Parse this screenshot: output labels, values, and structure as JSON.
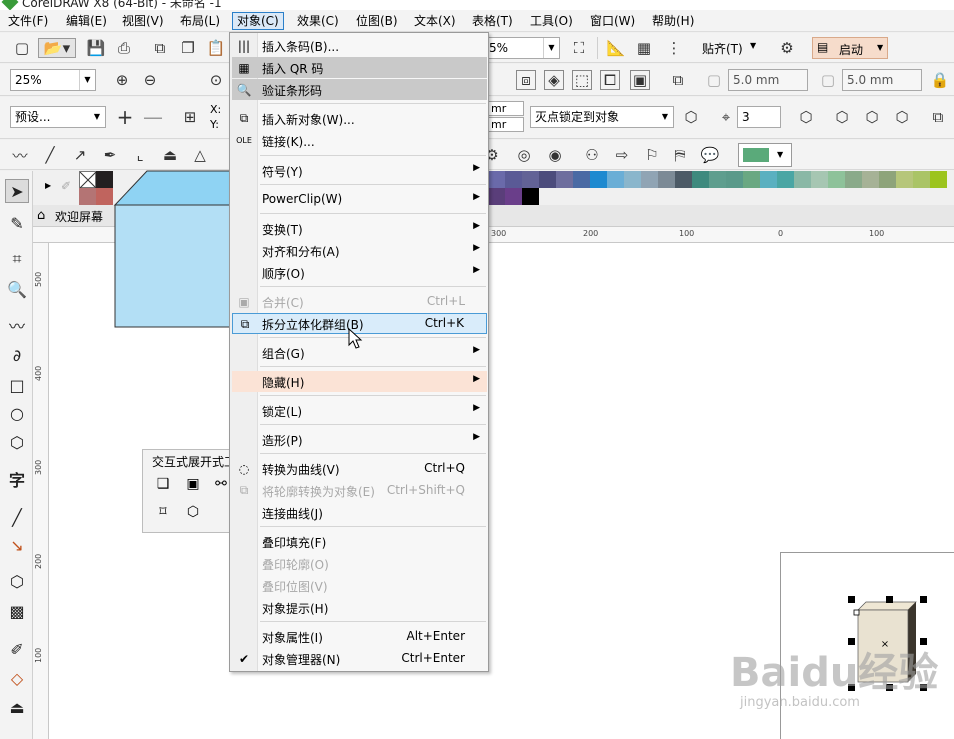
{
  "window": {
    "title": "CorelDRAW X8 (64-Bit) - 未命名 -1"
  },
  "menubar": {
    "items": [
      {
        "label": "文件(F)"
      },
      {
        "label": "编辑(E)"
      },
      {
        "label": "视图(V)"
      },
      {
        "label": "布局(L)"
      },
      {
        "label": "对象(C)"
      },
      {
        "label": "效果(C)"
      },
      {
        "label": "位图(B)"
      },
      {
        "label": "文本(X)"
      },
      {
        "label": "表格(T)"
      },
      {
        "label": "工具(O)"
      },
      {
        "label": "窗口(W)"
      },
      {
        "label": "帮助(H)"
      }
    ],
    "active_index": 4
  },
  "toolbar1": {
    "zoom_value": "5%",
    "snap_label": "贴齐(T)",
    "launch_label": "启动"
  },
  "toolbar2": {
    "zoom_value": "25%",
    "nudge_a": "5.0 mm",
    "nudge_b": "5.0 mm"
  },
  "toolbar3": {
    "preset_value": "预设...",
    "x_label": "X:",
    "y_label": "Y:",
    "unit_a": "mr",
    "unit_b": "mr",
    "vanish_option": "灭点锁定到对象",
    "depth_value": "3"
  },
  "docker_tab": {
    "label": "欢迎屏幕"
  },
  "ruler": {
    "h_ticks": [
      "300",
      "200",
      "100",
      "0",
      "100"
    ],
    "v_ticks": [
      "500",
      "400",
      "300",
      "200",
      "100"
    ]
  },
  "popup": {
    "title": "交互式展开式工"
  },
  "menu": {
    "items": [
      {
        "label": "插入条码(B)...",
        "shortcut": "",
        "submenu": false,
        "icon": "barcode-icon"
      },
      {
        "label": "插入 QR 码",
        "shortcut": "",
        "submenu": false,
        "icon": "qr-code-icon"
      },
      {
        "label": "验证条形码",
        "shortcut": "",
        "submenu": false,
        "icon": "verify-barcode-icon"
      },
      {
        "label": "插入新对象(W)...",
        "shortcut": "",
        "submenu": false,
        "icon": "insert-object-icon"
      },
      {
        "label": "链接(K)...",
        "shortcut": "",
        "submenu": false,
        "icon": "ole-link-icon"
      },
      {
        "label": "符号(Y)",
        "shortcut": "",
        "submenu": true
      },
      {
        "label": "PowerClip(W)",
        "shortcut": "",
        "submenu": true
      },
      {
        "label": "变换(T)",
        "shortcut": "",
        "submenu": true
      },
      {
        "label": "对齐和分布(A)",
        "shortcut": "",
        "submenu": true
      },
      {
        "label": "顺序(O)",
        "shortcut": "",
        "submenu": true
      },
      {
        "label": "合并(C)",
        "shortcut": "Ctrl+L",
        "submenu": false,
        "disabled": true,
        "icon": "combine-icon"
      },
      {
        "label": "拆分立体化群组(B)",
        "shortcut": "Ctrl+K",
        "submenu": false,
        "icon": "break-apart-icon"
      },
      {
        "label": "组合(G)",
        "shortcut": "",
        "submenu": true
      },
      {
        "label": "隐藏(H)",
        "shortcut": "",
        "submenu": true
      },
      {
        "label": "锁定(L)",
        "shortcut": "",
        "submenu": true
      },
      {
        "label": "造形(P)",
        "shortcut": "",
        "submenu": true
      },
      {
        "label": "转换为曲线(V)",
        "shortcut": "Ctrl+Q",
        "submenu": false,
        "icon": "convert-curves-icon"
      },
      {
        "label": "将轮廓转换为对象(E)",
        "shortcut": "Ctrl+Shift+Q",
        "submenu": false,
        "disabled": true,
        "icon": "outline-to-object-icon"
      },
      {
        "label": "连接曲线(J)",
        "shortcut": "",
        "submenu": false
      },
      {
        "label": "叠印填充(F)",
        "shortcut": "",
        "submenu": false
      },
      {
        "label": "叠印轮廓(O)",
        "shortcut": "",
        "submenu": false,
        "disabled": true
      },
      {
        "label": "叠印位图(V)",
        "shortcut": "",
        "submenu": false,
        "disabled": true
      },
      {
        "label": "对象提示(H)",
        "shortcut": "",
        "submenu": false
      },
      {
        "label": "对象属性(I)",
        "shortcut": "Alt+Enter",
        "submenu": false
      },
      {
        "label": "对象管理器(N)",
        "shortcut": "Ctrl+Enter",
        "submenu": false,
        "checked": true
      }
    ]
  },
  "watermark": {
    "main": "Baidu经验",
    "sub": "jingyan.baidu.com"
  },
  "colors": {
    "accent": "#2a7fc9",
    "box_fill": "#b3dff5",
    "highlight": "#fbe3d6",
    "fill_swatch": "#5aaa7a"
  }
}
